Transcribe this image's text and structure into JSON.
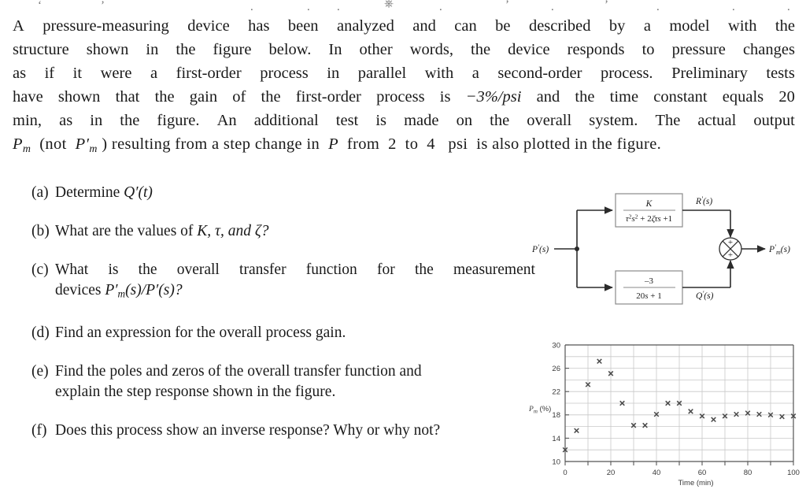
{
  "statement": {
    "lines": [
      "A pressure-measuring device has been analyzed and can be described by a model with the",
      "structure shown in the figure below.  In other words, the device responds to pressure changes",
      "as if it were a first-order process in parallel with a second-order process.  Preliminary tests",
      "have shown that the gain of the first-order process is −3%/psi and the time constant equals 20",
      "min, as in the figure.  An additional test is made on the overall system.  The actual output",
      "Pₘ (not P′ₘ) resulting from a step change in P from 2 to 4 psi is also plotted in the figure."
    ],
    "line1_words": [
      "A",
      "pressure-measuring",
      "device",
      "has",
      "been",
      "analyzed",
      "and",
      "can",
      "be",
      "described",
      "by",
      "a",
      "model",
      "with",
      "the"
    ],
    "line2_words": [
      "structure",
      "shown",
      "in",
      "the",
      "figure",
      "below.",
      "In",
      "other",
      "words,",
      "the",
      "device",
      "responds",
      "to",
      "pressure",
      "changes"
    ],
    "line3_words": [
      "as",
      "if",
      "it",
      "were",
      "a",
      "first-order",
      "process",
      "in",
      "parallel",
      "with",
      "a",
      "second-order",
      "process.",
      "Preliminary",
      "tests"
    ],
    "line4_words": [
      "have",
      "shown",
      "that",
      "the",
      "gain",
      "of",
      "the",
      "first-order",
      "process",
      "is",
      "−3%/psi",
      "and",
      "the",
      "time",
      "constant",
      "equals",
      "20"
    ],
    "line5_words": [
      "min,",
      "as",
      "in",
      "the",
      "figure.",
      "An",
      "additional",
      "test",
      "is",
      "made",
      "on",
      "the",
      "overall",
      "system.",
      "The",
      "actual",
      "output"
    ],
    "gain_text": "−3%/psi",
    "step_from": "2",
    "step_to": "4",
    "step_units": "psi",
    "time_constant": "20",
    "time_constant_units": "min"
  },
  "questions": [
    {
      "label": "(a)",
      "text": "Determine Q′(t)",
      "symbol": "Q′(t)",
      "lead": "Determine "
    },
    {
      "label": "(b)",
      "text": "What are the values of K, τ, and ζ?",
      "lead": "What are the values of ",
      "symbols": "K, τ, and ζ?"
    },
    {
      "label": "(c)",
      "line1": "What is the overall transfer function for the measurement",
      "line2": "devices P′ₘ(s)/P′(s)?",
      "line2_lead": "devices ",
      "line2_symbol": "P′ₘ(s)/P′(s)?"
    },
    {
      "label": "(d)",
      "text": "Find an expression for the overall process gain."
    },
    {
      "label": "(e)",
      "line1": "Find the poles and zeros of the overall transfer function and",
      "line2": "explain the step response shown in the figure."
    },
    {
      "label": "(f)",
      "text": "Does this process show an inverse response? Why or why not?"
    }
  ],
  "block_diagram": {
    "input_label": "P′(s)",
    "output_label": "P′ₘ(s)",
    "top_block": {
      "numerator": "K",
      "denominator": "τ²s² + 2ζτs +1",
      "output_label": "R′(s)"
    },
    "bottom_block": {
      "numerator": "–3",
      "denominator": "20s + 1",
      "output_label": "Q′(s)"
    },
    "summer": {
      "sign_top": "+",
      "sign_bottom": "+"
    }
  },
  "chart_data": {
    "type": "scatter",
    "title": "",
    "xlabel": "Time (min)",
    "ylabel": "Pₘ (%)",
    "xlim": [
      0,
      100
    ],
    "ylim": [
      10,
      30
    ],
    "xticks": [
      0,
      20,
      40,
      60,
      80,
      100
    ],
    "xtick_labels": [
      "0",
      "20",
      "40",
      "60",
      "80",
      "100"
    ],
    "xminor_step": 10,
    "yticks": [
      10,
      14,
      18,
      22,
      26,
      30
    ],
    "ytick_labels": [
      "10",
      "14",
      "18",
      "22",
      "26",
      "30"
    ],
    "yminor_step": 2,
    "grid": true,
    "legend": null,
    "marker": "x",
    "marker_color": "#4a4a4a",
    "x": [
      0,
      5,
      10,
      15,
      20,
      25,
      30,
      35,
      40,
      45,
      50,
      55,
      60,
      65,
      70,
      75,
      80,
      85,
      90,
      95,
      100
    ],
    "y": [
      12.0,
      15.3,
      23.2,
      27.2,
      25.1,
      20.0,
      16.2,
      16.2,
      18.1,
      20.0,
      20.0,
      18.6,
      17.8,
      17.2,
      17.8,
      18.1,
      18.3,
      18.1,
      18.0,
      17.7,
      17.8
    ]
  },
  "colors": {
    "text": "#1a1a1a",
    "grid": "#c8c8c8",
    "axis": "#555555",
    "block_border": "#8a8a8a",
    "line": "#2b2b2b"
  }
}
